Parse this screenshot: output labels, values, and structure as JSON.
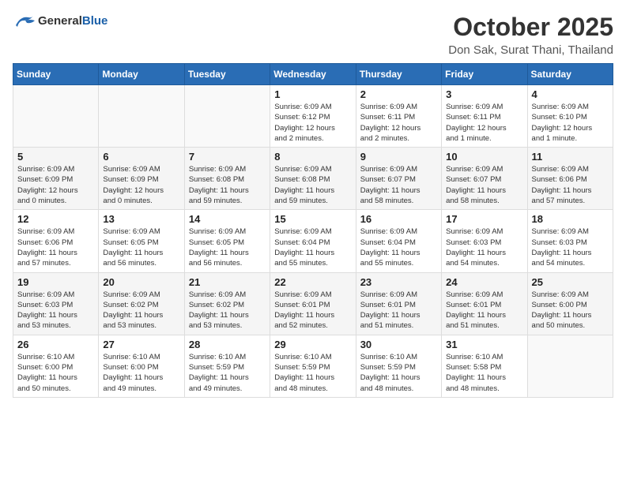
{
  "header": {
    "logo_general": "General",
    "logo_blue": "Blue",
    "title": "October 2025",
    "subtitle": "Don Sak, Surat Thani, Thailand"
  },
  "weekdays": [
    "Sunday",
    "Monday",
    "Tuesday",
    "Wednesday",
    "Thursday",
    "Friday",
    "Saturday"
  ],
  "weeks": [
    [
      {
        "day": "",
        "detail": ""
      },
      {
        "day": "",
        "detail": ""
      },
      {
        "day": "",
        "detail": ""
      },
      {
        "day": "1",
        "detail": "Sunrise: 6:09 AM\nSunset: 6:12 PM\nDaylight: 12 hours\nand 2 minutes."
      },
      {
        "day": "2",
        "detail": "Sunrise: 6:09 AM\nSunset: 6:11 PM\nDaylight: 12 hours\nand 2 minutes."
      },
      {
        "day": "3",
        "detail": "Sunrise: 6:09 AM\nSunset: 6:11 PM\nDaylight: 12 hours\nand 1 minute."
      },
      {
        "day": "4",
        "detail": "Sunrise: 6:09 AM\nSunset: 6:10 PM\nDaylight: 12 hours\nand 1 minute."
      }
    ],
    [
      {
        "day": "5",
        "detail": "Sunrise: 6:09 AM\nSunset: 6:09 PM\nDaylight: 12 hours\nand 0 minutes."
      },
      {
        "day": "6",
        "detail": "Sunrise: 6:09 AM\nSunset: 6:09 PM\nDaylight: 12 hours\nand 0 minutes."
      },
      {
        "day": "7",
        "detail": "Sunrise: 6:09 AM\nSunset: 6:08 PM\nDaylight: 11 hours\nand 59 minutes."
      },
      {
        "day": "8",
        "detail": "Sunrise: 6:09 AM\nSunset: 6:08 PM\nDaylight: 11 hours\nand 59 minutes."
      },
      {
        "day": "9",
        "detail": "Sunrise: 6:09 AM\nSunset: 6:07 PM\nDaylight: 11 hours\nand 58 minutes."
      },
      {
        "day": "10",
        "detail": "Sunrise: 6:09 AM\nSunset: 6:07 PM\nDaylight: 11 hours\nand 58 minutes."
      },
      {
        "day": "11",
        "detail": "Sunrise: 6:09 AM\nSunset: 6:06 PM\nDaylight: 11 hours\nand 57 minutes."
      }
    ],
    [
      {
        "day": "12",
        "detail": "Sunrise: 6:09 AM\nSunset: 6:06 PM\nDaylight: 11 hours\nand 57 minutes."
      },
      {
        "day": "13",
        "detail": "Sunrise: 6:09 AM\nSunset: 6:05 PM\nDaylight: 11 hours\nand 56 minutes."
      },
      {
        "day": "14",
        "detail": "Sunrise: 6:09 AM\nSunset: 6:05 PM\nDaylight: 11 hours\nand 56 minutes."
      },
      {
        "day": "15",
        "detail": "Sunrise: 6:09 AM\nSunset: 6:04 PM\nDaylight: 11 hours\nand 55 minutes."
      },
      {
        "day": "16",
        "detail": "Sunrise: 6:09 AM\nSunset: 6:04 PM\nDaylight: 11 hours\nand 55 minutes."
      },
      {
        "day": "17",
        "detail": "Sunrise: 6:09 AM\nSunset: 6:03 PM\nDaylight: 11 hours\nand 54 minutes."
      },
      {
        "day": "18",
        "detail": "Sunrise: 6:09 AM\nSunset: 6:03 PM\nDaylight: 11 hours\nand 54 minutes."
      }
    ],
    [
      {
        "day": "19",
        "detail": "Sunrise: 6:09 AM\nSunset: 6:03 PM\nDaylight: 11 hours\nand 53 minutes."
      },
      {
        "day": "20",
        "detail": "Sunrise: 6:09 AM\nSunset: 6:02 PM\nDaylight: 11 hours\nand 53 minutes."
      },
      {
        "day": "21",
        "detail": "Sunrise: 6:09 AM\nSunset: 6:02 PM\nDaylight: 11 hours\nand 53 minutes."
      },
      {
        "day": "22",
        "detail": "Sunrise: 6:09 AM\nSunset: 6:01 PM\nDaylight: 11 hours\nand 52 minutes."
      },
      {
        "day": "23",
        "detail": "Sunrise: 6:09 AM\nSunset: 6:01 PM\nDaylight: 11 hours\nand 51 minutes."
      },
      {
        "day": "24",
        "detail": "Sunrise: 6:09 AM\nSunset: 6:01 PM\nDaylight: 11 hours\nand 51 minutes."
      },
      {
        "day": "25",
        "detail": "Sunrise: 6:09 AM\nSunset: 6:00 PM\nDaylight: 11 hours\nand 50 minutes."
      }
    ],
    [
      {
        "day": "26",
        "detail": "Sunrise: 6:10 AM\nSunset: 6:00 PM\nDaylight: 11 hours\nand 50 minutes."
      },
      {
        "day": "27",
        "detail": "Sunrise: 6:10 AM\nSunset: 6:00 PM\nDaylight: 11 hours\nand 49 minutes."
      },
      {
        "day": "28",
        "detail": "Sunrise: 6:10 AM\nSunset: 5:59 PM\nDaylight: 11 hours\nand 49 minutes."
      },
      {
        "day": "29",
        "detail": "Sunrise: 6:10 AM\nSunset: 5:59 PM\nDaylight: 11 hours\nand 48 minutes."
      },
      {
        "day": "30",
        "detail": "Sunrise: 6:10 AM\nSunset: 5:59 PM\nDaylight: 11 hours\nand 48 minutes."
      },
      {
        "day": "31",
        "detail": "Sunrise: 6:10 AM\nSunset: 5:58 PM\nDaylight: 11 hours\nand 48 minutes."
      },
      {
        "day": "",
        "detail": ""
      }
    ]
  ]
}
